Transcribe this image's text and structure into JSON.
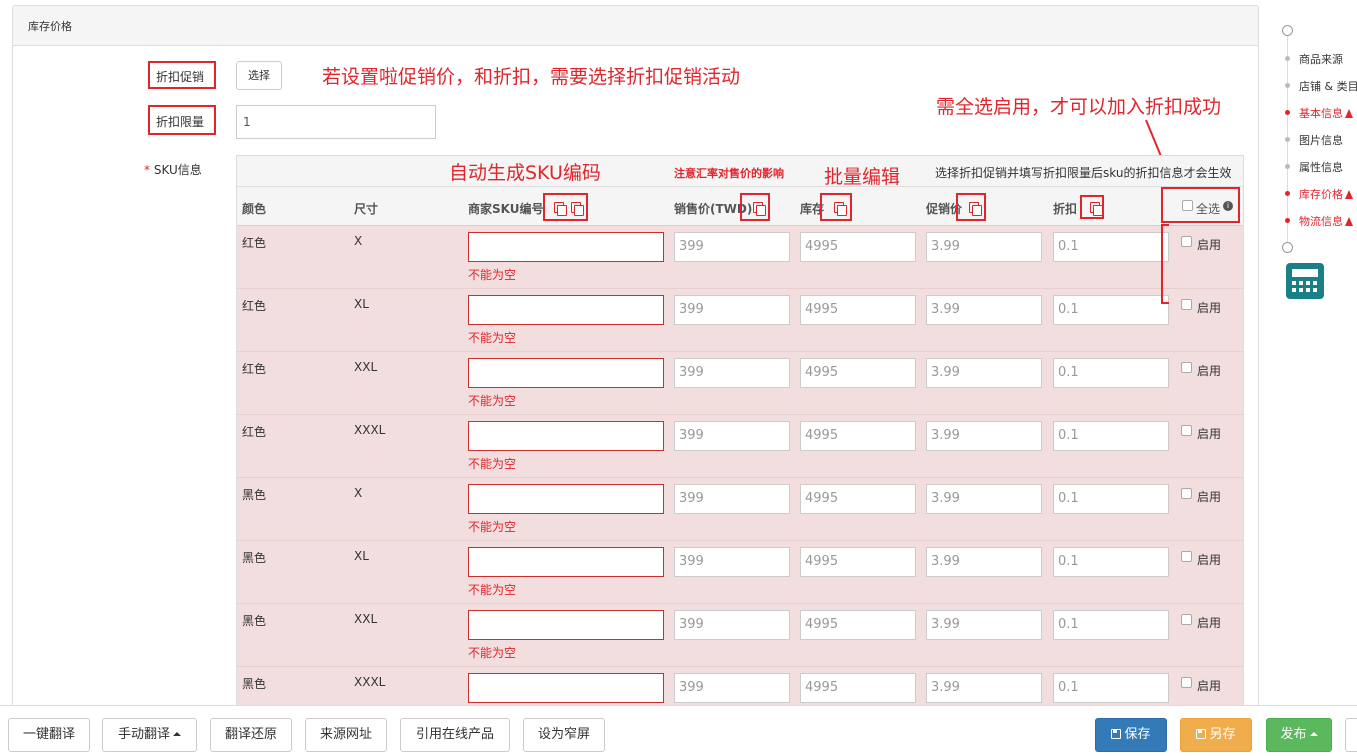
{
  "panel": {
    "title": "库存价格"
  },
  "form": {
    "discount_promo_label": "折扣促销",
    "select_button": "选择",
    "discount_limit_label": "折扣限量",
    "discount_limit_value": "1",
    "sku_info_required": "*",
    "sku_info_label": "SKU信息"
  },
  "annotations": {
    "promo_note": "若设置啦促销价，和折扣，需要选择折扣促销活动",
    "select_all_note": "需全选启用，才可以加入折扣成功",
    "auto_sku": "自动生成SKU编码",
    "batch_edit": "批量编辑"
  },
  "table": {
    "rate_note": "注意汇率对售价的影响",
    "effect_note": "选择折扣促销并填写折扣限量后sku的折扣信息才会生效",
    "headers": {
      "color": "颜色",
      "size": "尺寸",
      "sku_code": "商家SKU编号",
      "price": "销售价(TWD)",
      "stock": "库存",
      "promo_price": "促销价",
      "discount": "折扣",
      "select_all": "全选"
    },
    "error_text": "不能为空",
    "enable_label": "启用",
    "rows": [
      {
        "color": "红色",
        "size": "X",
        "price": "399",
        "stock": "4995",
        "promo": "3.99",
        "discount": "0.1",
        "error": true
      },
      {
        "color": "红色",
        "size": "XL",
        "price": "399",
        "stock": "4995",
        "promo": "3.99",
        "discount": "0.1",
        "error": true
      },
      {
        "color": "红色",
        "size": "XXL",
        "price": "399",
        "stock": "4995",
        "promo": "3.99",
        "discount": "0.1",
        "error": true
      },
      {
        "color": "红色",
        "size": "XXXL",
        "price": "399",
        "stock": "4995",
        "promo": "3.99",
        "discount": "0.1",
        "error": true
      },
      {
        "color": "黑色",
        "size": "X",
        "price": "399",
        "stock": "4995",
        "promo": "3.99",
        "discount": "0.1",
        "error": true
      },
      {
        "color": "黑色",
        "size": "XL",
        "price": "399",
        "stock": "4995",
        "promo": "3.99",
        "discount": "0.1",
        "error": true
      },
      {
        "color": "黑色",
        "size": "XXL",
        "price": "399",
        "stock": "4995",
        "promo": "3.99",
        "discount": "0.1",
        "error": true
      },
      {
        "color": "黑色",
        "size": "XXXL",
        "price": "399",
        "stock": "4995",
        "promo": "3.99",
        "discount": "0.1",
        "error": false
      }
    ]
  },
  "sidebar": {
    "items": [
      {
        "label": "商品来源",
        "state": "normal"
      },
      {
        "label": "店铺 & 类目",
        "state": "normal"
      },
      {
        "label": "基本信息",
        "state": "error"
      },
      {
        "label": "图片信息",
        "state": "normal"
      },
      {
        "label": "属性信息",
        "state": "normal"
      },
      {
        "label": "库存价格",
        "state": "error"
      },
      {
        "label": "物流信息",
        "state": "error"
      }
    ],
    "calculator_icon": "calculator-icon"
  },
  "toolbar": {
    "one_click_translate": "一键翻译",
    "manual_translate": "手动翻译",
    "restore_translation": "翻译还原",
    "source_url": "来源网址",
    "cite_online_product": "引用在线产品",
    "set_narrow": "设为窄屏",
    "save": "保存",
    "save_as": "另存",
    "publish": "发布"
  },
  "colors": {
    "annotation_red": "#e0262c",
    "row_bg": "#f2dede",
    "primary": "#337ab7",
    "warning": "#f0ad4e",
    "success": "#5cb85c",
    "calc": "#1a7f86"
  }
}
